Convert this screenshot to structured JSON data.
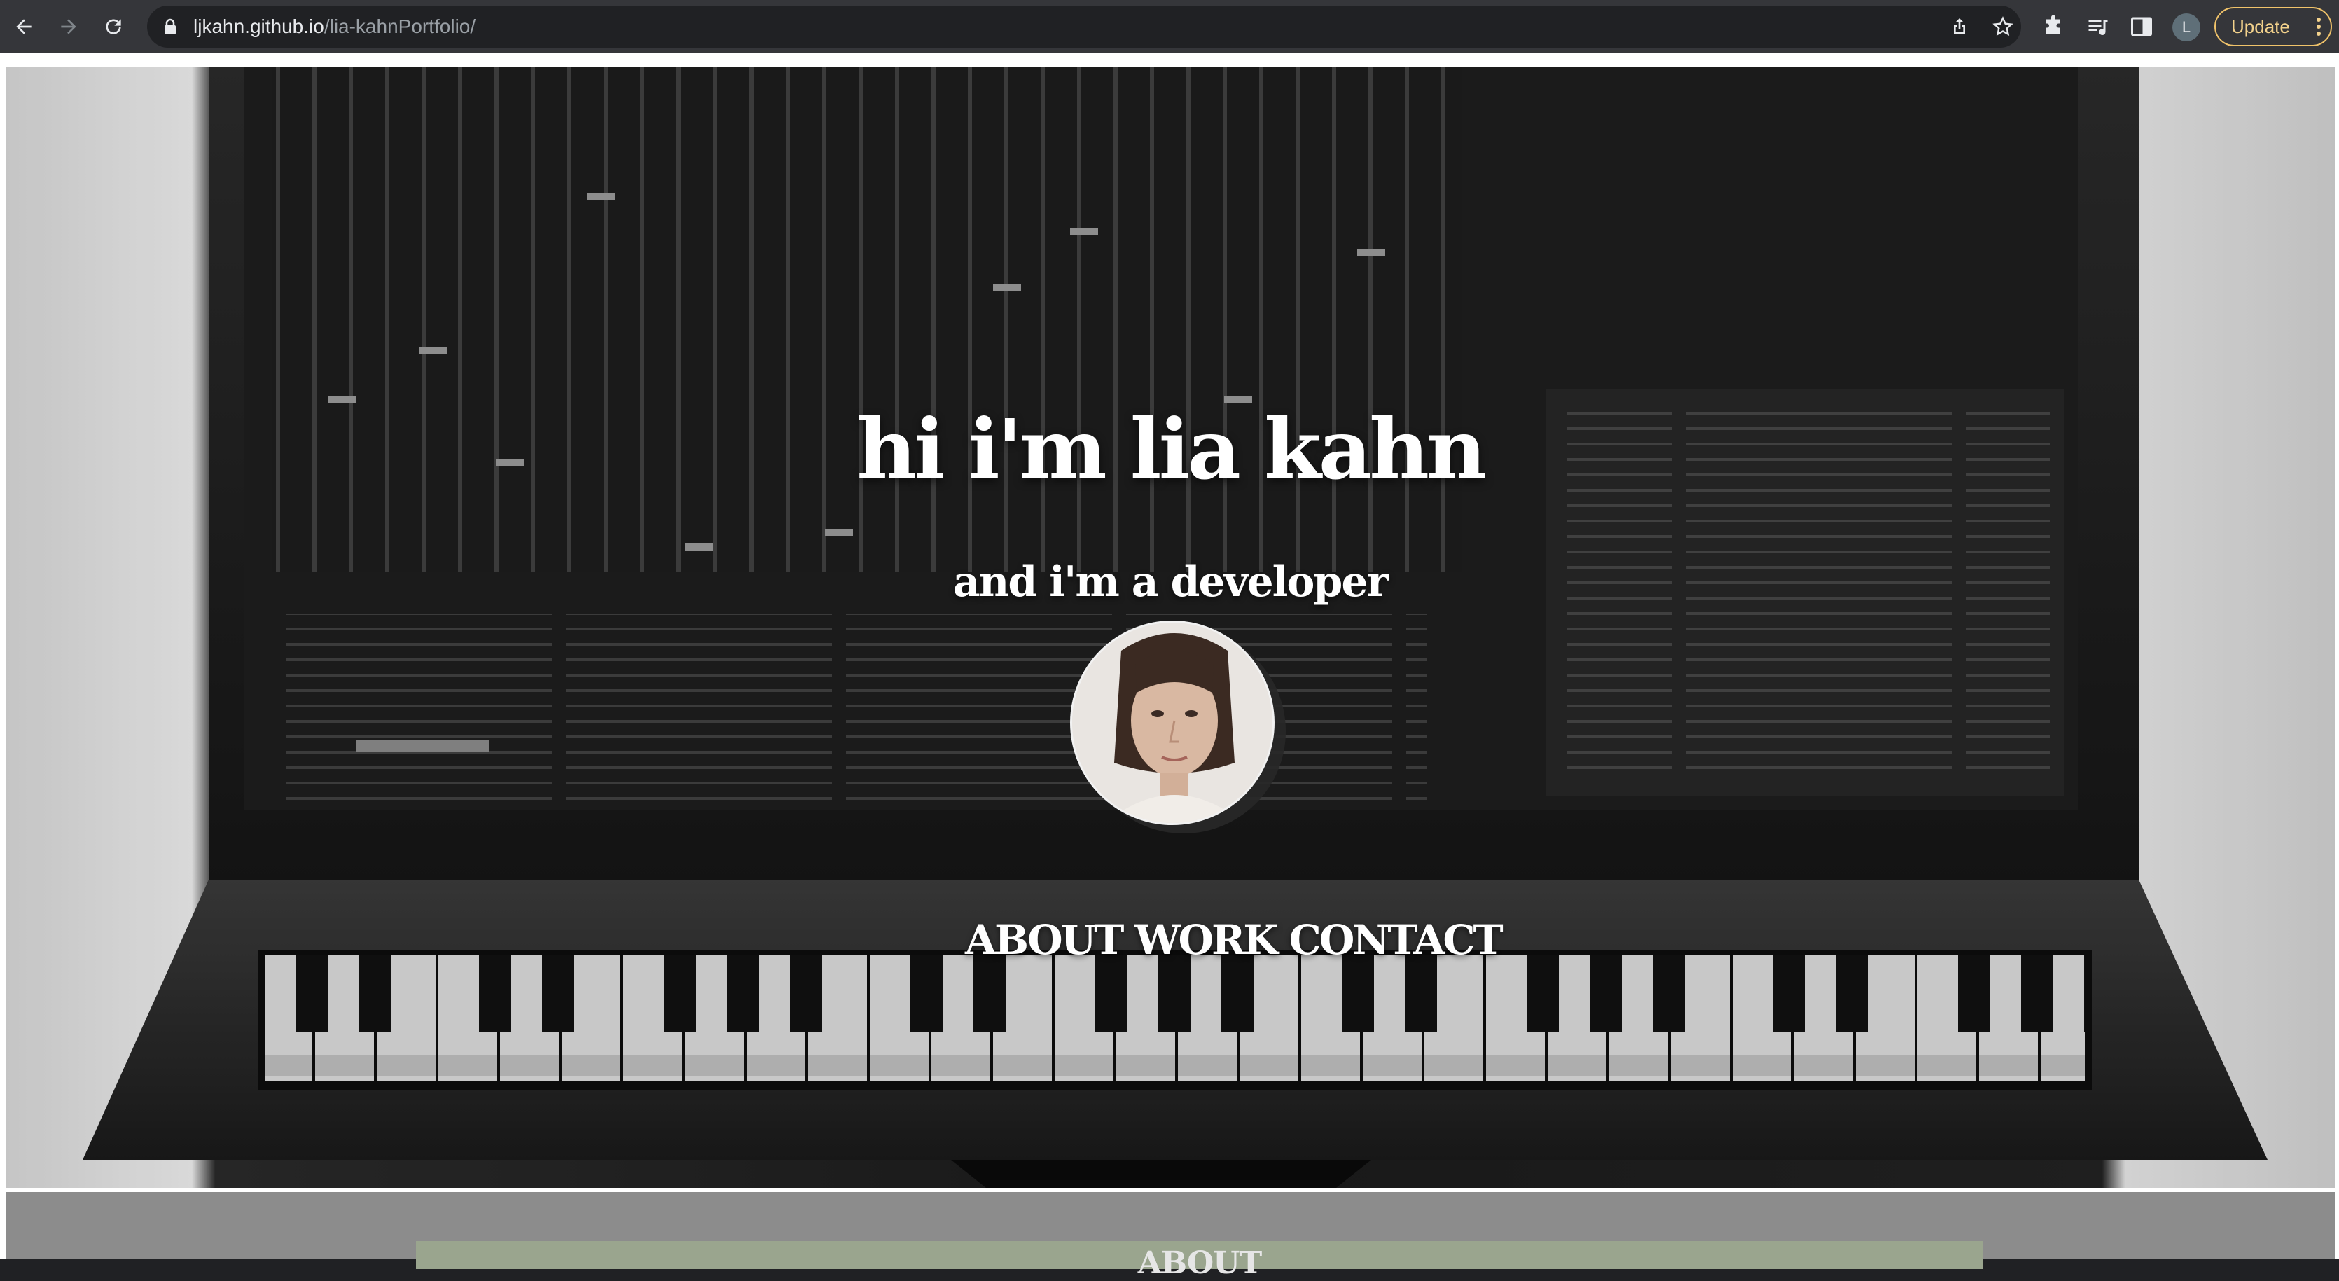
{
  "browser": {
    "url_host": "ljkahn.github.io",
    "url_path": "/lia-kahnPortfolio/",
    "profile_initial": "L",
    "update_label": "Update"
  },
  "hero": {
    "title": "hi i'm lia kahn",
    "subtitle": "and i'm a developer"
  },
  "nav": {
    "about": "ABOUT",
    "work": "WORK",
    "contact": "CONTACT"
  },
  "about_section": {
    "heading": "ABOUT"
  },
  "colors": {
    "chrome": "#35363a",
    "omnibox": "#202124",
    "update_accent": "#f0c36a",
    "about_bg": "#8c8c8c",
    "about_card": "#9aa58e"
  }
}
